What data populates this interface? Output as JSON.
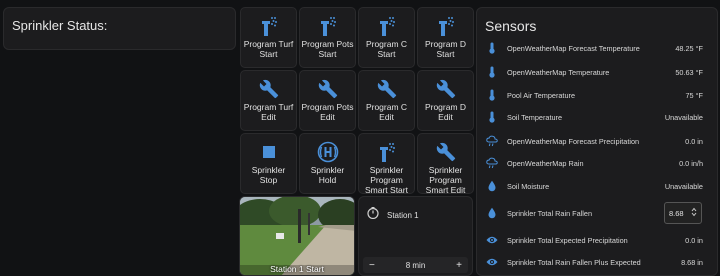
{
  "status": {
    "title": "Sprinkler Status:"
  },
  "buttons": [
    {
      "label": "Program Turf Start",
      "icon": "sprinkler-icon"
    },
    {
      "label": "Program Pots Start",
      "icon": "sprinkler-icon"
    },
    {
      "label": "Program C Start",
      "icon": "sprinkler-icon"
    },
    {
      "label": "Program D Start",
      "icon": "sprinkler-icon"
    },
    {
      "label": "Program Turf Edit",
      "icon": "wrench-icon"
    },
    {
      "label": "Program Pots Edit",
      "icon": "wrench-icon"
    },
    {
      "label": "Program C Edit",
      "icon": "wrench-icon"
    },
    {
      "label": "Program D Edit",
      "icon": "wrench-icon"
    },
    {
      "label": "Sprinkler Stop",
      "icon": "stop-icon"
    },
    {
      "label": "Sprinkler Hold",
      "icon": "hold-icon"
    },
    {
      "label": "Sprinkler Program Smart Start",
      "icon": "sprinkler-icon"
    },
    {
      "label": "Sprinkler Program Smart Edit",
      "icon": "wrench-icon"
    }
  ],
  "camera": {
    "caption": "Station 1 Start"
  },
  "station": {
    "name": "Station 1",
    "value": "8 min",
    "minus": "−",
    "plus": "+"
  },
  "sensors": {
    "title": "Sensors",
    "rows": [
      {
        "name": "OpenWeatherMap Forecast Temperature",
        "value": "48.25 °F",
        "icon": "thermometer-icon"
      },
      {
        "name": "OpenWeatherMap Temperature",
        "value": "50.63 °F",
        "icon": "thermometer-icon"
      },
      {
        "name": "Pool Air Temperature",
        "value": "75 °F",
        "icon": "thermometer-icon"
      },
      {
        "name": "Soil Temperature",
        "value": "Unavailable",
        "icon": "thermometer-icon"
      },
      {
        "name": "OpenWeatherMap Forecast Precipitation",
        "value": "0.0 in",
        "icon": "cloud-rain-icon"
      },
      {
        "name": "OpenWeatherMap Rain",
        "value": "0.0 in/h",
        "icon": "cloud-rain-icon"
      },
      {
        "name": "Soil Moisture",
        "value": "Unavailable",
        "icon": "water-drop-icon"
      },
      {
        "name": "Sprinkler Total Rain Fallen",
        "value": "8.68",
        "icon": "water-drop-icon"
      },
      {
        "name": "Sprinkler Total Expected Precipitation",
        "value": "0.0 in",
        "icon": "eye-icon"
      },
      {
        "name": "Sprinkler Total Rain Fallen Plus Expected",
        "value": "8.68 in",
        "icon": "eye-icon"
      }
    ]
  },
  "colors": {
    "accent": "#4a90d9",
    "card": "#1c1c1e",
    "background": "#111214"
  }
}
